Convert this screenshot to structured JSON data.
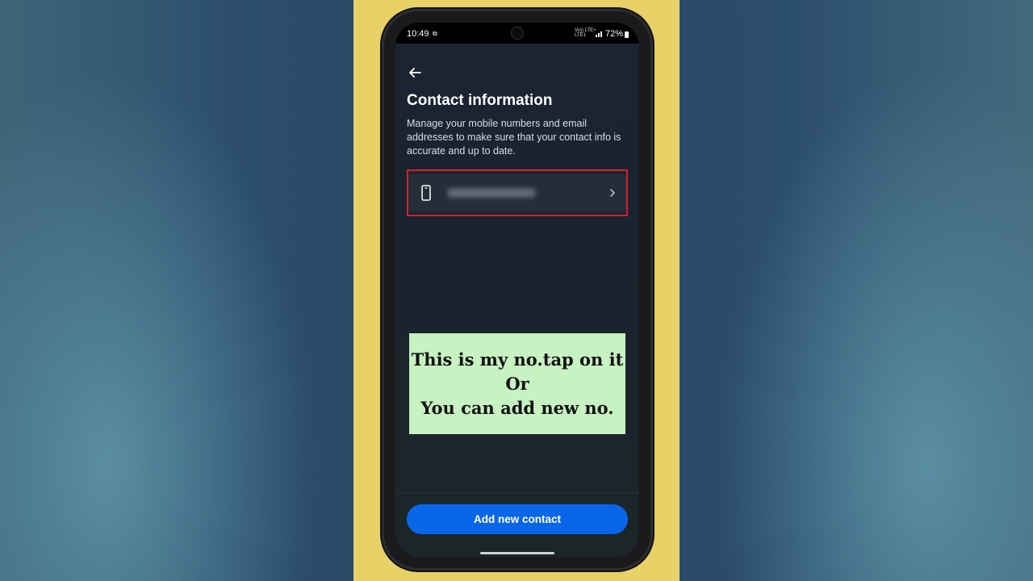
{
  "status_bar": {
    "time": "10:49",
    "network_top": "Vo)) LTE+",
    "network_bottom": "LTE1",
    "battery_percent": "72%"
  },
  "page": {
    "title": "Contact information",
    "description": "Manage your mobile numbers and email addresses to make sure that your contact info is accurate and up to date."
  },
  "contact_row": {
    "icon": "phone-icon",
    "value": "",
    "chevron": "chevron-right-icon"
  },
  "footer": {
    "add_button_label": "Add new contact"
  },
  "annotation": {
    "line1": "This is my no.tap on it",
    "line2": "Or",
    "line3": "You can add new no."
  },
  "colors": {
    "accent_button": "#0a66e8",
    "highlight_border": "#e21b23",
    "caption_background": "#c7f2c1",
    "side_panel": "#e8d166"
  }
}
